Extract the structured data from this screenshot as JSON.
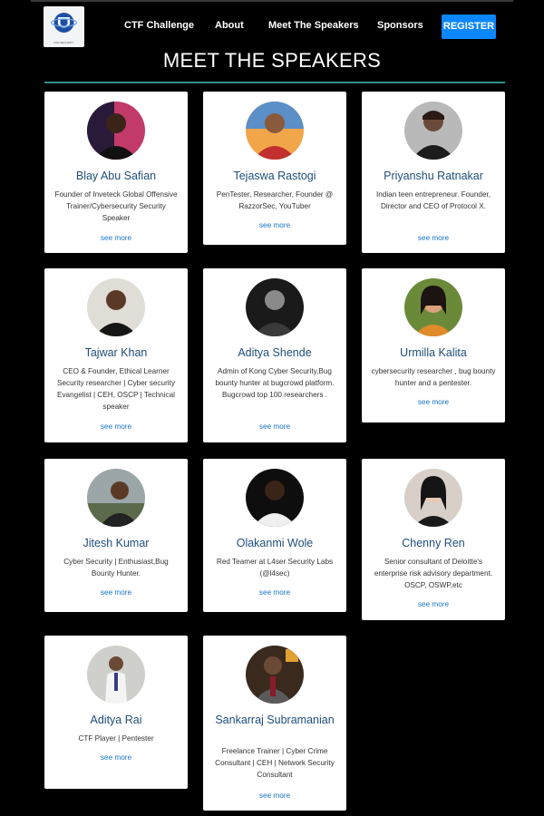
{
  "nav": {
    "logo_text": "RSA SECURITY",
    "links": [
      "CTF Challenge",
      "About",
      "Meet The Speakers",
      "Sponsors"
    ],
    "register_label": "REGISTER"
  },
  "page_title": "MEET THE SPEAKERS",
  "speakers": [
    {
      "name": "Blay Abu Safian",
      "desc": "Founder of Inveteck Global Offensive Trainer/Cybersecurity Security Speaker",
      "link": "see more"
    },
    {
      "name": "Tejaswa Rastogi",
      "desc": "PenTester, Researcher, Founder @ RazzorSec, YouTuber",
      "link": "see more"
    },
    {
      "name": "Priyanshu Ratnakar",
      "desc": "Indian teen entrepreneur. Founder, Director and CEO of Protocol X.",
      "link": "see more"
    },
    {
      "name": "Tajwar Khan",
      "desc": "CEO & Founder, Ethical Learner Security researcher | Cyber security Evangelist | CEH, OSCP | Technical speaker",
      "link": "see more"
    },
    {
      "name": "Aditya Shende",
      "desc": "Admin of Kong Cyber Security,Bug bounty hunter at bugcrowd platform. Bugcrowd top 100 researchers .",
      "link": "see more"
    },
    {
      "name": "Urmilla Kalita",
      "desc": "cybersecurity researcher , bug bounty hunter and a pentester.",
      "link": "see more"
    },
    {
      "name": "Jitesh Kumar",
      "desc": "Cyber Security | Enthusiast,Bug Bounty Hunter.",
      "link": "see more"
    },
    {
      "name": "Olakanmi Wole",
      "desc": "Red Teamer at L4ser Security Labs (@l4sec)",
      "link": "see more"
    },
    {
      "name": "Chenny Ren",
      "desc": "Senior consultant of Deloitte's enterprise risk advisory department. OSCP, OSWP,etc",
      "link": "see more"
    },
    {
      "name": "Aditya Rai",
      "desc": "CTF Player | Pentester",
      "link": "see more"
    },
    {
      "name": "Sankarraj Subramanian",
      "desc": "Freelance Trainer | Cyber Crime Consultant | CEH | Network Security Consultant",
      "link": "see more"
    }
  ]
}
